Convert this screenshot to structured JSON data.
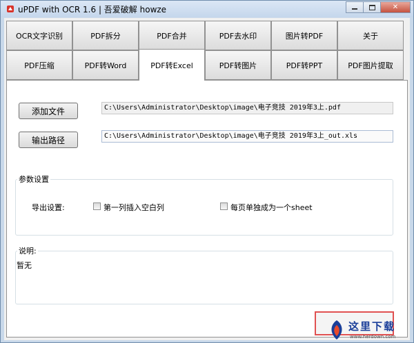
{
  "window": {
    "title": "uPDF with OCR 1.6 | 吾爱破解 howze",
    "minimize_icon": "minimize-icon",
    "maximize_icon": "maximize-icon",
    "close_label": "✕"
  },
  "tabs": {
    "row1": [
      "OCR文字识别",
      "PDF拆分",
      "PDF合并",
      "PDF去水印",
      "图片转PDF",
      "关于"
    ],
    "row2": [
      "PDF压缩",
      "PDF转Word",
      "PDF转Excel",
      "PDF转图片",
      "PDF转PPT",
      "PDF图片提取"
    ],
    "active": "PDF转Excel"
  },
  "form": {
    "add_file_button": "添加文件",
    "input_path": "C:\\Users\\Administrator\\Desktop\\image\\电子竞技 2019年3上.pdf",
    "output_button": "输出路径",
    "output_path": "C:\\Users\\Administrator\\Desktop\\image\\电子竞技 2019年3上_out.xls"
  },
  "params": {
    "legend": "参数设置",
    "export_label": "导出设置:",
    "option1_label": "第一列插入空白列",
    "option1_checked": false,
    "option2_label": "每页单独成为一个sheet",
    "option2_checked": false
  },
  "notes": {
    "legend": "说明:",
    "text": "暂无"
  },
  "watermark": {
    "text": "这里下载",
    "url": "www.herdown.com"
  },
  "colors": {
    "title_bar": "#c8d8ea",
    "close_button": "#c5523f",
    "highlight_border": "#e05050",
    "watermark_blue": "#1a3e99"
  }
}
